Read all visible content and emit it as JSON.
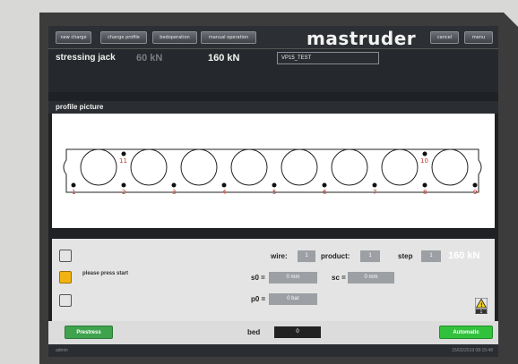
{
  "header": {
    "buttons": [
      "new charge",
      "change profile",
      "bedoperation",
      "manual operation"
    ],
    "logo": "mastruder",
    "right_buttons": [
      "cancel",
      "menu"
    ]
  },
  "jack": {
    "label": "stressing jack",
    "value_actual": "60 kN",
    "value_target": "160 kN",
    "recipe": "VP15_TEST"
  },
  "profile": {
    "title": "profile picture",
    "points": [
      "1",
      "2",
      "3",
      "4",
      "5",
      "6",
      "7",
      "8",
      "9",
      "10",
      "11"
    ]
  },
  "panel": {
    "message": "please press start",
    "wire_label": "wire:",
    "wire_value": "1",
    "product_label": "product:",
    "product_value": "1",
    "step_label": "step",
    "step_value": "1",
    "step_force": "160 kN",
    "s0_label": "s0 =",
    "s0_value": "0 mm",
    "sc_label": "sc =",
    "sc_value": "0 mm",
    "p_label": "p0 =",
    "p_value": "0 bar",
    "warning_count": "1"
  },
  "footer": {
    "prestress_label": "Prestress",
    "bed_label": "bed",
    "bed_value": "0",
    "auto_label": "Automatic"
  },
  "status": {
    "user": "admin",
    "datetime": "15/02/2019 08:15:48"
  },
  "colors": {
    "accent_green": "#3fa34d",
    "auto_green": "#32c13c",
    "amber": "#f2b312"
  }
}
